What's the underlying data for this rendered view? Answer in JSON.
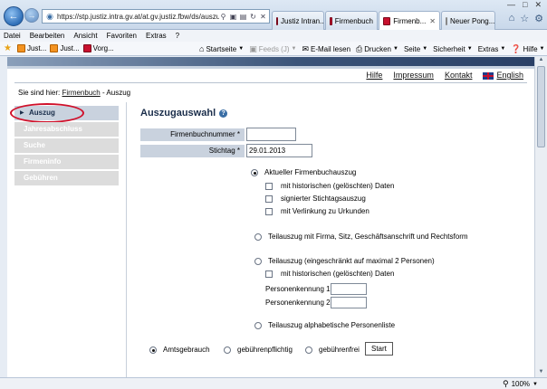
{
  "browser": {
    "address_url": "https://stp.justiz.intra.gv.at/at.gv.justiz.fbw/ds/auszug/formu",
    "tabs": [
      {
        "label": "Justiz Intran..."
      },
      {
        "label": "Firmenbuch"
      },
      {
        "label": "Firmenb...",
        "active": true
      },
      {
        "label": "Neuer Pong..."
      }
    ],
    "menu": [
      "Datei",
      "Bearbeiten",
      "Ansicht",
      "Favoriten",
      "Extras",
      "?"
    ],
    "favorites": [
      {
        "label": "Just..."
      },
      {
        "label": "Just..."
      },
      {
        "label": "Vorg..."
      }
    ],
    "commands": {
      "home": "Startseite",
      "feeds": "Feeds (J)",
      "mail": "E-Mail lesen",
      "print": "Drucken",
      "page": "Seite",
      "safety": "Sicherheit",
      "tools": "Extras",
      "help": "Hilfe"
    },
    "zoom": "100%"
  },
  "colors": {
    "banner_dark": "#2a4066",
    "nav_active": "#c9d2de",
    "nav_inactive": "#dcdcdc",
    "highlight": "#d0102a"
  },
  "toplinks": {
    "help": "Hilfe",
    "impressum": "Impressum",
    "contact": "Kontakt",
    "language": "English"
  },
  "breadcrumb": {
    "prefix": "Sie sind hier:",
    "link": "Firmenbuch",
    "separator": "-",
    "current": "Auszug"
  },
  "sidebar": {
    "items": [
      {
        "label": "Auszug",
        "active": true
      },
      {
        "label": "Jahresabschluss"
      },
      {
        "label": "Suche"
      },
      {
        "label": "Firmeninfo"
      },
      {
        "label": "Gebühren"
      }
    ]
  },
  "form": {
    "title": "Auszugauswahl",
    "fields": {
      "firmenbuchnummer": {
        "label": "Firmenbuchnummer *",
        "value": ""
      },
      "stichtag": {
        "label": "Stichtag *",
        "value": "29.01.2013"
      }
    },
    "options": {
      "aktuell": {
        "label": "Aktueller Firmenbuchauszug",
        "selected": true
      },
      "aktuell_hist": "mit historischen (gelöschten) Daten",
      "signiert": "signierter Stichtagsauszug",
      "urkunden": "mit Verlinkung zu Urkunden",
      "teil_firma": "Teilauszug mit Firma, Sitz, Geschäftsanschrift und Rechtsform",
      "teil_personen": "Teilauszug (eingeschränkt auf maximal 2 Personen)",
      "teil_hist": "mit historischen (gelöschten) Daten",
      "personenkennung1": "Personenkennung 1",
      "personenkennung2": "Personenkennung 2",
      "alphabetisch": "Teilauszug alphabetische Personenliste"
    },
    "fees": {
      "amtsgebrauch": {
        "label": "Amtsgebrauch",
        "selected": true
      },
      "pflichtig": "gebührenpflichtig",
      "frei": "gebührenfrei"
    },
    "start_label": "Start"
  }
}
